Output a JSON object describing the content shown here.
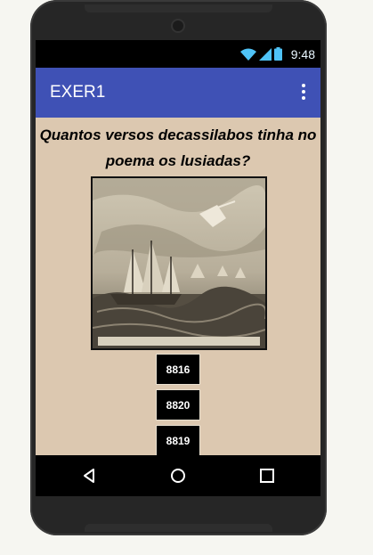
{
  "status_bar": {
    "time": "9:48",
    "icons": [
      "wifi-icon",
      "signal-icon",
      "battery-icon"
    ]
  },
  "app_bar": {
    "title": "EXER1",
    "menu_icon": "overflow-menu-icon"
  },
  "content": {
    "question": "Quantos versos decassilabos tinha no poema os lusiadas?",
    "image_icon": "sailing-ships-engraving",
    "answers": [
      "8816",
      "8820",
      "8819"
    ]
  },
  "nav_bar": {
    "icons": [
      "back-icon",
      "home-icon",
      "recents-icon"
    ]
  },
  "colors": {
    "app_bar": "#3f51b5",
    "content_bg": "#dcc8b0",
    "button_bg": "#000000"
  }
}
